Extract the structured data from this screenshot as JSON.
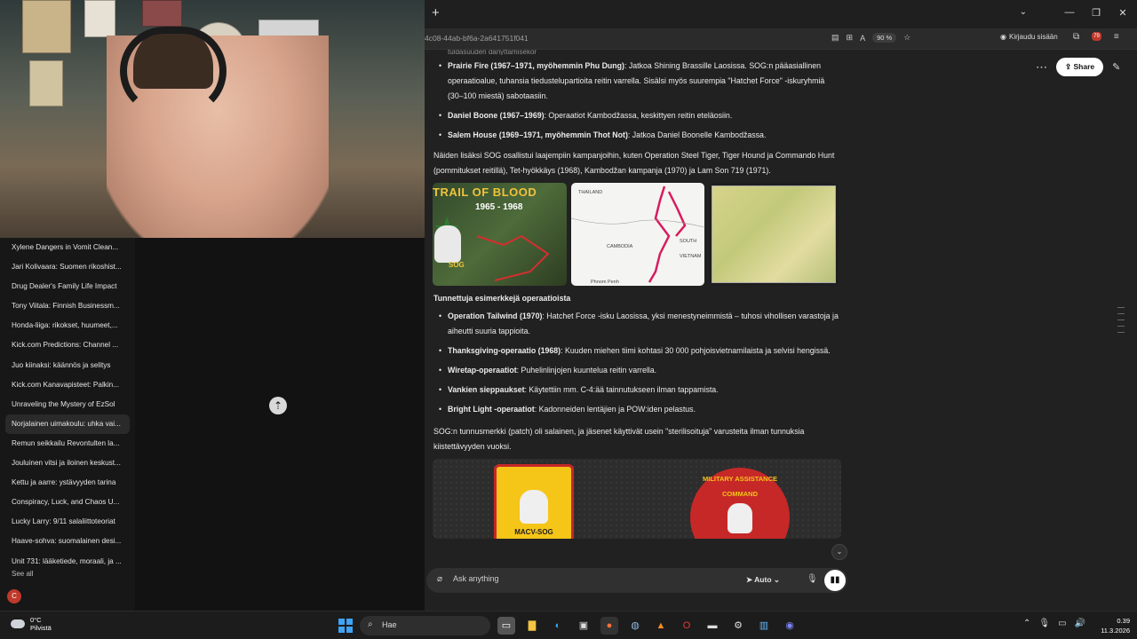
{
  "sidebar": {
    "items": [
      "Xylene Dangers in Vomit Clean...",
      "Jari Kolivaara: Suomen rikoshist...",
      "Drug Dealer's Family Life Impact",
      "Tony Viitala: Finnish Businessm...",
      "Honda-liiga: rikokset, huumeet,...",
      "Kick.com Predictions: Channel ...",
      "Juo kiinaksi: käännös ja selitys",
      "Kick.com Kanavapisteet: Palkin...",
      "Unraveling the Mystery of EzSol",
      "Norjalainen uimakoulu: uhka vai...",
      "Remun seikkailu Revontulten la...",
      "Jouluinen vitsi ja iloinen keskust...",
      "Kettu ja aarre: ystävyyden tarina",
      "Conspiracy, Luck, and Chaos U...",
      "Lucky Larry: 9/11 salaliittoteoriat",
      "Haave-sohva: suomalainen desi...",
      "Unit 731: lääketiede, moraali, ja ..."
    ],
    "active_index": 9,
    "see_all": "See all",
    "avatar_letter": "C"
  },
  "browser": {
    "new_tab": "+",
    "url": "4c08-44ab-bf6a-2a641751f041",
    "zoom": "90 %",
    "signin": "Kirjaudu sisään",
    "ext_badge": "79"
  },
  "page": {
    "share": "Share",
    "clipped_line": "tuldasuuden danyttamisekor",
    "ops_list_1": [
      {
        "bold": "Prairie Fire (1967–1971, myöhemmin Phu Dung)",
        "text": ": Jatkoa Shining Brassille Laosissa. SOG:n pääasiallinen operaatioalue, tuhansia tiedustelupartioita reitin varrella. Sisälsi myös suurempia \"Hatchet Force\" -iskuryhmiä (30–100 miestä) sabotaasiin."
      },
      {
        "bold": "Daniel Boone (1967–1969)",
        "text": ": Operaatiot Kambodžassa, keskittyen reitin eteläosiin."
      },
      {
        "bold": "Salem House (1969–1971, myöhemmin Thot Not)",
        "text": ": Jatkoa Daniel Boonelle Kambodžassa."
      }
    ],
    "para1": "Näiden lisäksi SOG osallistui laajempiin kampanjoihin, kuten Operation Steel Tiger, Tiger Hound ja Commando Hunt (pommitukset reitillä), Tet-hyökkäys (1968), Kambodžan kampanja (1970) ja Lam Son 719 (1971).",
    "image1": {
      "title": "TRAIL OF BLOOD",
      "years": "1965 - 1968",
      "logo": "SOG"
    },
    "image2": {
      "thailand": "THAILAND",
      "cambodia": "CAMBODIA",
      "south_vietnam": "SOUTH VIETNAM",
      "phnom_penh": "Phnom Penh"
    },
    "subhead": "Tunnettuja esimerkkejä operaatioista",
    "ops_list_2": [
      {
        "bold": "Operation Tailwind (1970)",
        "text": ": Hatchet Force -isku Laosissa, yksi menestyneimmistä – tuhosi vihollisen varastoja ja aiheutti suuria tappioita."
      },
      {
        "bold": "Thanksgiving-operaatio (1968)",
        "text": ": Kuuden miehen tiimi kohtasi 30 000 pohjoisvietnamilaista ja selvisi hengissä."
      },
      {
        "bold": "Wiretap-operaatiot",
        "text": ": Puhelinlinjojen kuuntelua reitin varrella."
      },
      {
        "bold": "Vankien sieppaukset",
        "text": ": Käytettiin mm. C-4:ää tainnutukseen ilman tappamista."
      },
      {
        "bold": "Bright Light -operaatiot",
        "text": ": Kadonneiden lentäjien ja POW:iden pelastus."
      }
    ],
    "para2": "SOG:n tunnusmerkki (patch) oli salainen, ja jäsenet käyttivät usein \"sterilisoituja\" varusteita ilman tunnuksia kiistettävyyden vuoksi.",
    "patch1_text": "MACV-SOG",
    "patch2_text": "MILITARY ASSISTANCE COMMAND"
  },
  "composer": {
    "placeholder": "Ask anything",
    "mode": "Auto"
  },
  "taskbar": {
    "temp": "0°C",
    "condition": "Pilvistä",
    "search": "Hae",
    "time": "0.39",
    "date": "11.3.2026"
  }
}
